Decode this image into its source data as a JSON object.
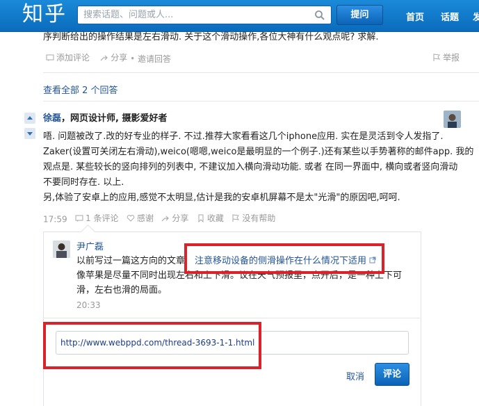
{
  "header": {
    "logo": "知乎",
    "search_placeholder": "搜索话题、问题或人...",
    "ask_button": "提问",
    "nav": [
      "首页",
      "话题",
      "发"
    ]
  },
  "previous_answer": {
    "text": "序判断给出的操作结果是左右滑动. 关于这个滑动操作,各位大神有什么观点呢? 求解.",
    "actions": {
      "comment": "添加评论",
      "share": "分享",
      "invite": "邀请回答",
      "report": "举报"
    }
  },
  "view_all": "查看全部 2 个回答",
  "answer": {
    "author_name": "徐磊",
    "author_bio": "，网页设计师, 摄影爱好者",
    "lines": [
      "唔. 问题被改了.改的好专业的样子. 不过.推荐大家看看这几个iphone应用. 实在是灵活到令人发指了.",
      "Zaker(设置可关闭左右滑动),weico(嗯嗯,weico是最明显的一个例子.)还有某些以手势著称的邮件app. 我的",
      "观点是. 某些较长的竖向排列的列表中, 不建议加入横向滑动功能. 或者 在同一界面中, 横向或者竖向滑动",
      "不要同时存在. 以上.",
      "另,体验了安卓上的应用,感觉不太明显,估计是我的安卓机屏幕不是太\"光滑\"的原因吧,呵呵."
    ],
    "time": "17:59",
    "actions": {
      "comments": "1 条评论",
      "thanks": "感谢",
      "share": "分享",
      "collect": "收藏",
      "not_helpful": "没有帮助"
    }
  },
  "comment": {
    "author": "尹广磊",
    "text_before_link": "以前写过一篇这方向的文章,",
    "link_text": "注意移动设备的侧滑操作在什么情况下适用",
    "line2": "像苹果是尽量不同时出现左右和上下滑。议在天气预报里，点开后，是一种上下可",
    "line3": "滑，左右也滑的局面。",
    "time": "20:33"
  },
  "comment_input": {
    "value": "http://www.webppd.com/thread-3693-1-1.html",
    "cancel": "取消",
    "submit": "评论"
  },
  "colors": {
    "brand": "#0b6bbd",
    "link": "#225599",
    "highlight": "#d9222a"
  }
}
